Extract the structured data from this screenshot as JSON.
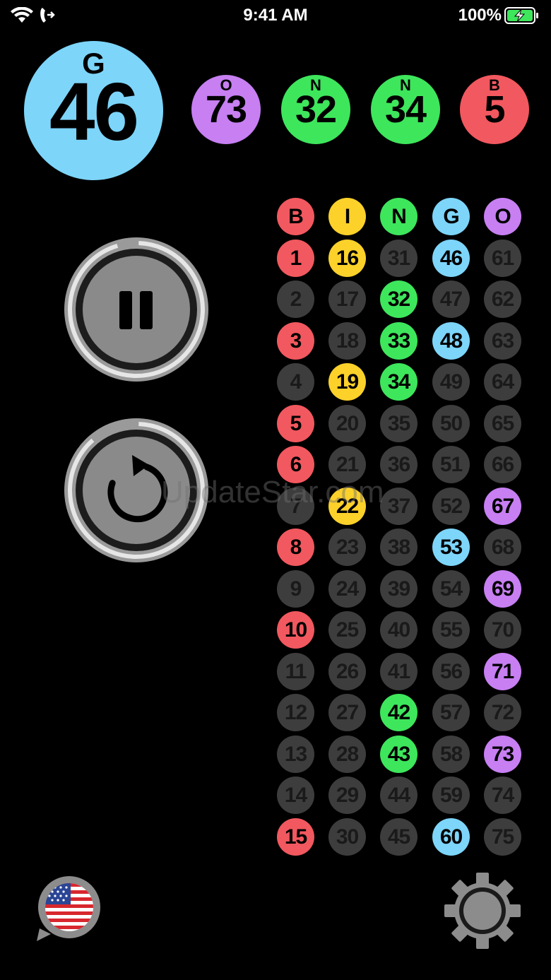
{
  "status_bar": {
    "time": "9:41 AM",
    "battery": "100%"
  },
  "colors": {
    "B": "#f2585f",
    "I": "#fcd12a",
    "N": "#3ee65c",
    "G": "#7dd5fa",
    "O": "#c77ff2",
    "off": "#3d3d3d"
  },
  "current_ball": {
    "letter": "G",
    "number": "46",
    "color": "#7dd5fa"
  },
  "recent_balls": [
    {
      "letter": "O",
      "number": "73",
      "color": "#c77ff2"
    },
    {
      "letter": "N",
      "number": "32",
      "color": "#3ee65c"
    },
    {
      "letter": "N",
      "number": "34",
      "color": "#3ee65c"
    },
    {
      "letter": "B",
      "number": "5",
      "color": "#f2585f"
    }
  ],
  "controls": {
    "pause": "pause-icon",
    "reset": "reset-icon"
  },
  "board": {
    "headers": [
      "B",
      "I",
      "N",
      "G",
      "O"
    ],
    "columns": [
      {
        "numbers": [
          1,
          2,
          3,
          4,
          5,
          6,
          7,
          8,
          9,
          10,
          11,
          12,
          13,
          14,
          15
        ],
        "called": [
          1,
          3,
          5,
          6,
          8,
          10,
          15
        ]
      },
      {
        "numbers": [
          16,
          17,
          18,
          19,
          20,
          21,
          22,
          23,
          24,
          25,
          26,
          27,
          28,
          29,
          30
        ],
        "called": [
          16,
          19,
          22
        ]
      },
      {
        "numbers": [
          31,
          32,
          33,
          34,
          35,
          36,
          37,
          38,
          39,
          40,
          41,
          42,
          43,
          44,
          45
        ],
        "called": [
          32,
          33,
          34,
          42,
          43
        ]
      },
      {
        "numbers": [
          46,
          47,
          48,
          49,
          50,
          51,
          52,
          53,
          54,
          55,
          56,
          57,
          58,
          59,
          60
        ],
        "called": [
          46,
          48,
          53,
          60
        ]
      },
      {
        "numbers": [
          61,
          62,
          63,
          64,
          65,
          66,
          67,
          68,
          69,
          70,
          71,
          72,
          73,
          74,
          75
        ],
        "called": [
          67,
          69,
          71,
          73
        ]
      }
    ]
  },
  "watermark": "UpdateStar.com",
  "bottom": {
    "language": "us-flag-icon",
    "settings": "gear-icon"
  }
}
